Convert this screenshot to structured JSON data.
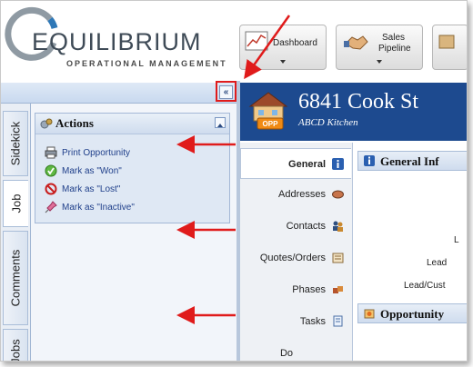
{
  "header": {
    "logo_word": "EQUILIBRIUM",
    "logo_sub": "OPERATIONAL MANAGEMENT",
    "buttons": [
      {
        "label": "Dashboard",
        "icon": "chart-icon"
      },
      {
        "label_line1": "Sales",
        "label_line2": "Pipeline",
        "icon": "handshake-icon"
      }
    ]
  },
  "sidekick": {
    "collapse_label": "«",
    "tabs": [
      "Sidekick",
      "Job",
      "Comments",
      "Jobs"
    ],
    "active_tab": "Job",
    "actions": {
      "title": "Actions",
      "items": [
        {
          "label": "Print Opportunity",
          "icon": "printer-icon"
        },
        {
          "label": "Mark as \"Won\"",
          "icon": "check-icon"
        },
        {
          "label": "Mark as \"Lost\"",
          "icon": "no-icon"
        },
        {
          "label": "Mark as \"Inactive\"",
          "icon": "pin-icon"
        }
      ]
    }
  },
  "record": {
    "title": "6841 Cook St",
    "subtitle": "ABCD Kitchen",
    "badge": "OPP"
  },
  "nav": [
    {
      "label": "General",
      "icon": "info-icon",
      "active": true
    },
    {
      "label": "Addresses",
      "icon": "address-icon"
    },
    {
      "label": "Contacts",
      "icon": "contacts-icon"
    },
    {
      "label": "Quotes/Orders",
      "icon": "quotes-icon"
    },
    {
      "label": "Phases",
      "icon": "phases-icon"
    },
    {
      "label": "Tasks",
      "icon": "tasks-icon"
    },
    {
      "label": "Do",
      "icon": ""
    }
  ],
  "content": {
    "general_head": "General Inf",
    "field_labels": [
      "L",
      "Lead",
      "Lead/Cust"
    ],
    "opportunity_head": "Opportunity"
  },
  "colors": {
    "title_bar": "#1d4a8f",
    "link": "#1f3f8a",
    "annotation_arrow": "#e01b1b"
  }
}
